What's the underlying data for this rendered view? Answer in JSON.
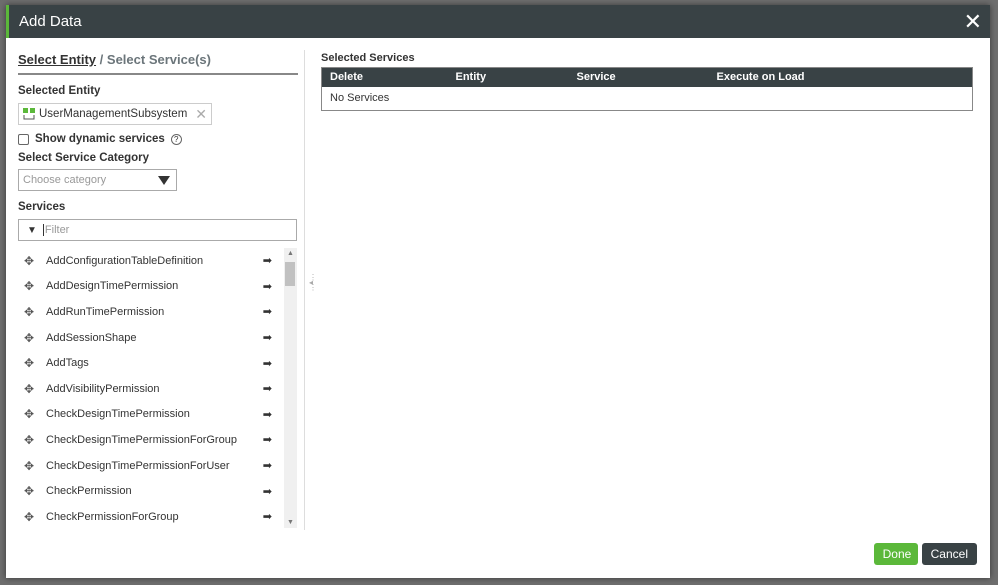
{
  "dialog": {
    "title": "Add Data",
    "close_icon": "close-icon"
  },
  "steps": {
    "step1": "Select Entity",
    "sep": "/",
    "step2": "Select Service(s)"
  },
  "selected_entity": {
    "label": "Selected Entity",
    "value": "UserManagementSubsystem"
  },
  "dynamic": {
    "label": "Show dynamic services",
    "checked": false,
    "help": "?"
  },
  "category": {
    "label": "Select Service Category",
    "placeholder": "Choose category"
  },
  "services": {
    "label": "Services",
    "filter_placeholder": "Filter",
    "items": [
      "AddConfigurationTableDefinition",
      "AddDesignTimePermission",
      "AddRunTimePermission",
      "AddSessionShape",
      "AddTags",
      "AddVisibilityPermission",
      "CheckDesignTimePermission",
      "CheckDesignTimePermissionForGroup",
      "CheckDesignTimePermissionForUser",
      "CheckPermission",
      "CheckPermissionForGroup"
    ]
  },
  "selected_services": {
    "title": "Selected Services",
    "columns": [
      "Delete",
      "Entity",
      "Service",
      "Execute on Load"
    ],
    "empty": "No Services"
  },
  "footer": {
    "done": "Done",
    "cancel": "Cancel"
  },
  "colors": {
    "header": "#394245",
    "accent": "#5bb83a"
  }
}
